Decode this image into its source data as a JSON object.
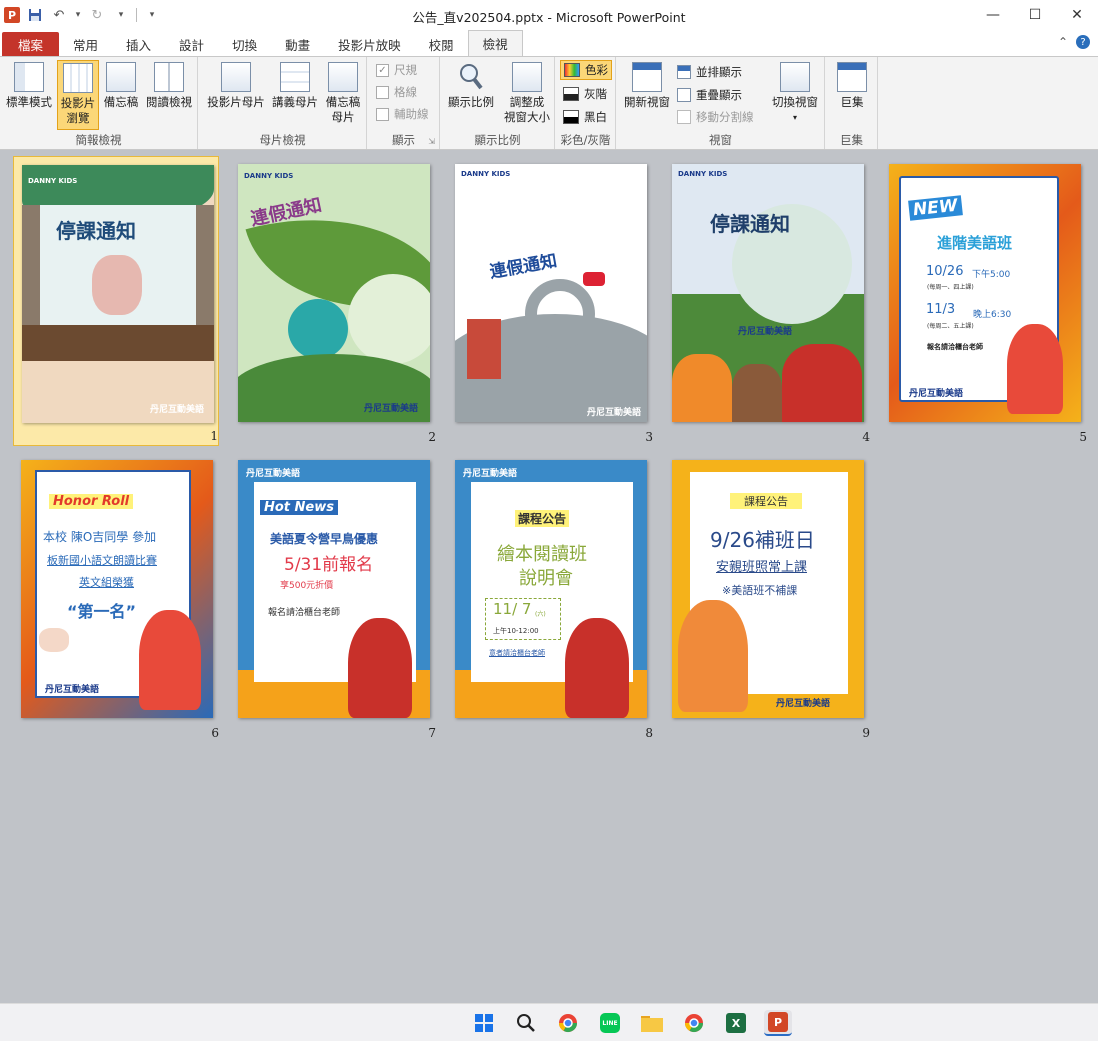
{
  "window": {
    "title": "公告_直v202504.pptx - Microsoft PowerPoint",
    "app_icon_letter": "P"
  },
  "tabs": [
    {
      "label": "檔案"
    },
    {
      "label": "常用"
    },
    {
      "label": "插入"
    },
    {
      "label": "設計"
    },
    {
      "label": "切換"
    },
    {
      "label": "動畫"
    },
    {
      "label": "投影片放映"
    },
    {
      "label": "校閱"
    },
    {
      "label": "檢視"
    }
  ],
  "ribbon": {
    "presentation_views": {
      "label": "簡報檢視",
      "normal": "標準模式",
      "sorter_line1": "投影片",
      "sorter_line2": "瀏覽",
      "notes": "備忘稿",
      "reading": "閱讀檢視"
    },
    "master_views": {
      "label": "母片檢視",
      "slide_master": "投影片母片",
      "handout_master": "講義母片",
      "notes_master_line1": "備忘稿",
      "notes_master_line2": "母片"
    },
    "show": {
      "label": "顯示",
      "ruler": "尺規",
      "gridlines": "格線",
      "guides": "輔助線"
    },
    "zoom": {
      "label": "顯示比例",
      "zoom": "顯示比例",
      "fit_line1": "調整成",
      "fit_line2": "視窗大小"
    },
    "color": {
      "label": "彩色/灰階",
      "color": "色彩",
      "grayscale": "灰階",
      "bw": "黑白"
    },
    "window": {
      "label": "視窗",
      "new_window": "開新視窗",
      "arrange_all": "並排顯示",
      "cascade": "重疊顯示",
      "move_split": "移動分割線",
      "switch_line1": "切換視窗"
    },
    "macros": {
      "label": "巨集",
      "macros": "巨集"
    }
  },
  "slides": [
    {
      "number": "1",
      "title": "停課通知",
      "brand": "丹尼互動美語",
      "logo": "DANNY KIDS",
      "bg": "#f0d9c0"
    },
    {
      "number": "2",
      "title": "連假通知",
      "brand": "丹尼互動美語",
      "logo": "DANNY KIDS",
      "bg": "#cfe6c0"
    },
    {
      "number": "3",
      "title": "連假通知",
      "brand": "丹尼互動美語",
      "logo": "DANNY KIDS",
      "bg": "#ffffff"
    },
    {
      "number": "4",
      "title": "停課通知",
      "brand": "丹尼互動美語",
      "logo": "DANNY KIDS",
      "bg": "#4d8a3a"
    },
    {
      "number": "5",
      "badge": "NEW",
      "title": "進階美語班",
      "line1_date": "10/26",
      "line1_time": "下午5:00",
      "line1_note": "(每周一、四上課)",
      "line2_date": "11/3",
      "line2_time": "晚上6:30",
      "line2_note": "(每周二、五上課)",
      "contact": "報名請洽櫃台老師",
      "brand": "丹尼互動美語"
    },
    {
      "number": "6",
      "badge": "Honor Roll",
      "line1": "本校 陳O吉同學 參加",
      "line2": "板新國小語文朗讀比賽",
      "line3": "英文組榮獲",
      "line4": "“第一名”",
      "brand": "丹尼互動美語"
    },
    {
      "number": "7",
      "badge": "Hot News",
      "line1": "美語夏令營早鳥優惠",
      "line2": "5/31前報名",
      "line3": "享500元折價",
      "line4": "報名請洽櫃台老師",
      "brand": "丹尼互動美語"
    },
    {
      "number": "8",
      "badge": "課程公告",
      "line1": "繪本閱讀班",
      "line2": "說明會",
      "date": "11/ 7",
      "date_suffix": "(六)",
      "time": "上午10-12:00",
      "contact": "意者請洽櫃台老師",
      "brand": "丹尼互動美語"
    },
    {
      "number": "9",
      "badge": "課程公告",
      "line1": "9/26補班日",
      "line2": "安親班照常上課",
      "line3": "※美語班不補課",
      "brand": "丹尼互動美語"
    }
  ],
  "colors": {
    "file_tab": "#c4342a",
    "selected_btn": "#fbd778",
    "workspace": "#c0c3c8"
  }
}
